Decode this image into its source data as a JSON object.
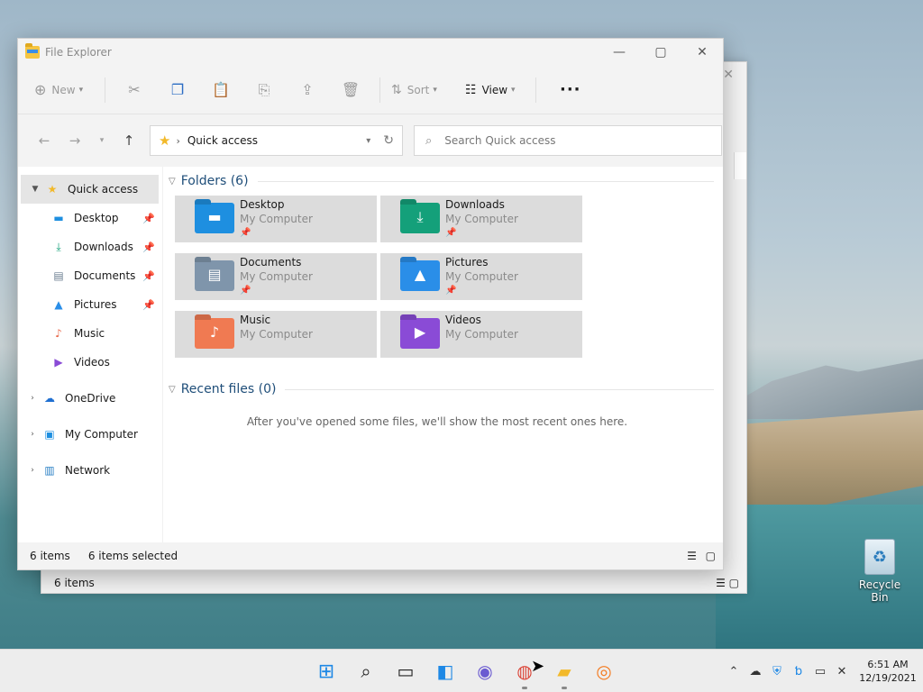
{
  "window": {
    "title": "File Explorer"
  },
  "toolbar": {
    "new_label": "New",
    "sort_label": "Sort",
    "view_label": "View"
  },
  "address": {
    "location": "Quick access"
  },
  "search": {
    "placeholder": "Search Quick access"
  },
  "sidebar": {
    "quick_access": "Quick access",
    "pinned": [
      {
        "label": "Desktop",
        "icon": "desktop-icon"
      },
      {
        "label": "Downloads",
        "icon": "downloads-icon"
      },
      {
        "label": "Documents",
        "icon": "documents-icon"
      },
      {
        "label": "Pictures",
        "icon": "pictures-icon"
      },
      {
        "label": "Music",
        "icon": "music-icon"
      },
      {
        "label": "Videos",
        "icon": "videos-icon"
      }
    ],
    "onedrive": "OneDrive",
    "my_computer": "My Computer",
    "network": "Network"
  },
  "folders": {
    "header": "Folders (6)",
    "items": [
      {
        "name": "Desktop",
        "location": "My Computer",
        "color": "#1e8fe0"
      },
      {
        "name": "Downloads",
        "location": "My Computer",
        "color": "#14a07a"
      },
      {
        "name": "Documents",
        "location": "My Computer",
        "color": "#7f95ab"
      },
      {
        "name": "Pictures",
        "location": "My Computer",
        "color": "#2a8ee8"
      },
      {
        "name": "Music",
        "location": "My Computer",
        "color": "#f07a52"
      },
      {
        "name": "Videos",
        "location": "My Computer",
        "color": "#8a4bd6"
      }
    ]
  },
  "recent": {
    "header": "Recent files (0)",
    "empty_message": "After you've opened some files, we'll show the most recent ones here."
  },
  "status": {
    "items": "6 items",
    "selected": "6 items selected"
  },
  "background_window": {
    "status": "6 items"
  },
  "desktop": {
    "recycle_bin": "Recycle Bin"
  },
  "clock": {
    "time": "6:51 AM",
    "date": "12/19/2021"
  }
}
